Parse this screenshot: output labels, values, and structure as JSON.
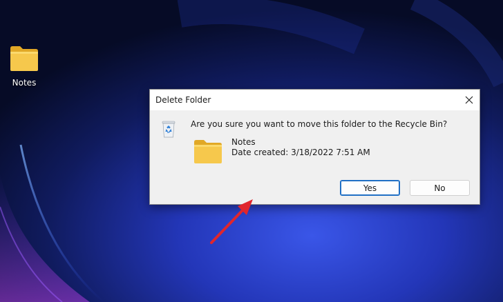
{
  "desktop": {
    "icons": [
      {
        "label": "Notes",
        "icon": "folder-icon"
      }
    ]
  },
  "dialog": {
    "title": "Delete Folder",
    "close_icon": "close-icon",
    "question": "Are you sure you want to move this folder to the Recycle Bin?",
    "item": {
      "name": "Notes",
      "date_created": "Date created: 3/18/2022 7:51 AM",
      "icon": "folder-icon"
    },
    "header_icon": "recycle-bin-icon",
    "buttons": {
      "yes": "Yes",
      "no": "No"
    }
  },
  "annotation": {
    "icon": "arrow-pointer-icon",
    "color": "#e0262d"
  },
  "colors": {
    "dialog_background": "#f0f0f0",
    "titlebar_background": "#ffffff",
    "default_button_border": "#1f6fc5",
    "folder_yellow": "#f4c84a",
    "wallpaper_accent": "#2a3fd0"
  }
}
